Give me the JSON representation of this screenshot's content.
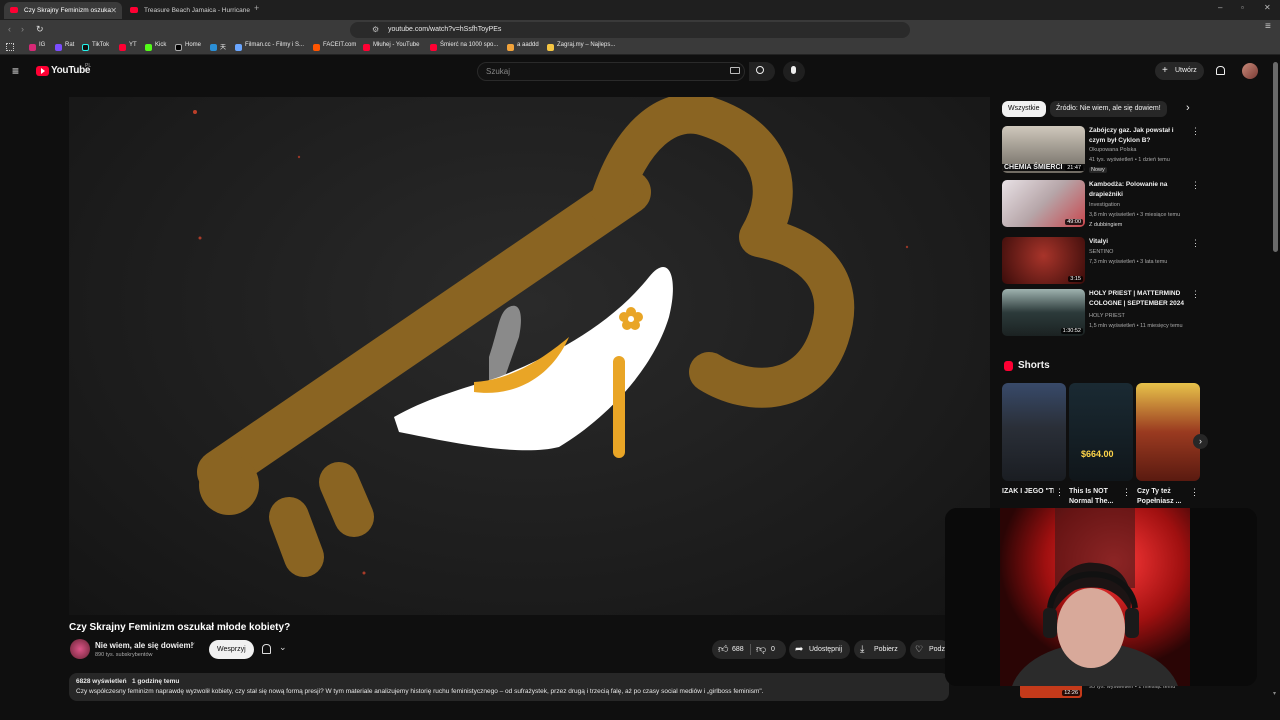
{
  "browser": {
    "tabs": [
      {
        "title": "Czy Skrajny Feminizm oszuka"
      },
      {
        "title": "Treasure Beach Jamaica - Hurricane"
      }
    ],
    "new_tab": "+",
    "url": "youtube.com/watch?v=hSsfhToyPEs",
    "bookmarks": [
      "IG",
      "Rat",
      "TikTok",
      "YT",
      "Kick",
      "Home",
      "天",
      "Filman.cc - Filmy i S...",
      "FACEIT.com",
      "Młuhej - YouTube",
      "Śmierć na 1000 spo...",
      "a aaddd",
      "Zagraj.my – Najleps..."
    ]
  },
  "youtube": {
    "logo": "YouTube",
    "region": "PL",
    "search_placeholder": "Szukaj",
    "create_label": "Utwórz"
  },
  "video": {
    "title": "Czy Skrajny Feminizm oszukał młode kobiety?",
    "channel": "Nie wiem, ale się dowiem!",
    "subscribers": "890 tys. subskrybentów",
    "support_label": "Wesprzyj",
    "likes": "688",
    "dislikes": "0",
    "share_label": "Udostępnij",
    "download_label": "Pobierz",
    "thanks_label": "Podz",
    "views": "6828 wyświetleń",
    "posted": "1 godzinę temu",
    "description": "Czy współczesny feminizm naprawdę wyzwolił kobiety, czy stał się nową formą presji? W tym materiale analizujemy historię ruchu feministycznego – od sufrażystek, przez drugą i trzecią falę, aż po czasy social mediów i „girlboss feminism\"."
  },
  "chips": [
    "Wszystkie",
    "Źródło: Nie wiem, ale się dowiem!"
  ],
  "recommended": [
    {
      "title": "Zabójczy gaz. Jak powstał i czym był Cyklon B?",
      "channel": "Okupowana Polska",
      "meta": "41 tys. wyświetleń • 1 dzień temu",
      "badge": "Nowy",
      "duration": "21:47",
      "thumb_text": "CHEMIA ŚMIERCI"
    },
    {
      "title": "Kambodża: Polowanie na drapieżniki",
      "channel": "Investigation",
      "meta": "3,8 mln wyświetleń • 3 miesiące temu",
      "badge": "Z dubbingiem",
      "duration": "49:00"
    },
    {
      "title": "Vitalyi",
      "channel": "SENTINO",
      "meta": "7,3 mln wyświetleń • 3 lata temu",
      "badge": "",
      "duration": "3:15"
    },
    {
      "title": "HOLY PRIEST | MATTERMIND COLOGNE | SEPTEMBER 2024",
      "channel": "HOLY PRIEST",
      "meta": "1,5 mln wyświetleń • 11 miesięcy temu",
      "badge": "",
      "duration": "1:30:52"
    }
  ],
  "shorts": {
    "heading": "Shorts",
    "items": [
      {
        "title": "IZAK I JEGO \"TRAGICZN..."
      },
      {
        "title": "This Is NOT Normal The..."
      },
      {
        "title": "Czy Ty też Popełniasz ..."
      }
    ],
    "price_overlay": "$664.00"
  },
  "hidden_row": {
    "duration": "12:26",
    "meta": "95 tys. wyświetleń • 1 miesiąc temu"
  },
  "colors": {
    "accent": "#ff0033",
    "key": "#8a6422",
    "shoe_gold": "#e9a526"
  }
}
